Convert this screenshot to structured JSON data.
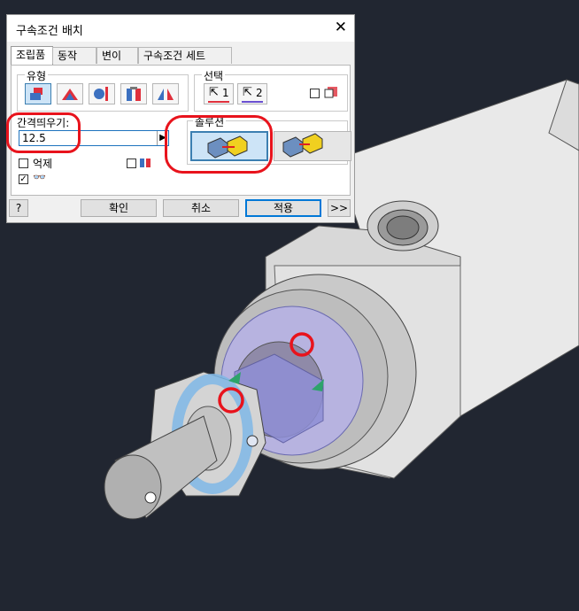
{
  "dialog": {
    "title": "구속조건 배치",
    "tabs": [
      "조립품",
      "동작",
      "변이",
      "구속조건 세트"
    ],
    "type_group_label": "유형",
    "select_group_label": "선택",
    "select_1_label": "1",
    "select_2_label": "2",
    "offset_label": "간격띄우기:",
    "offset_value": "12.5",
    "solution_group_label": "솔루션",
    "suppress_label": "억제",
    "ok_label": "확인",
    "cancel_label": "취소",
    "apply_label": "적용",
    "more_label": ">>",
    "help_label": "?"
  },
  "colors": {
    "highlight_red": "#e8131c",
    "selection_blue": "#3c7fb1",
    "viewport_bg": "#212631"
  }
}
